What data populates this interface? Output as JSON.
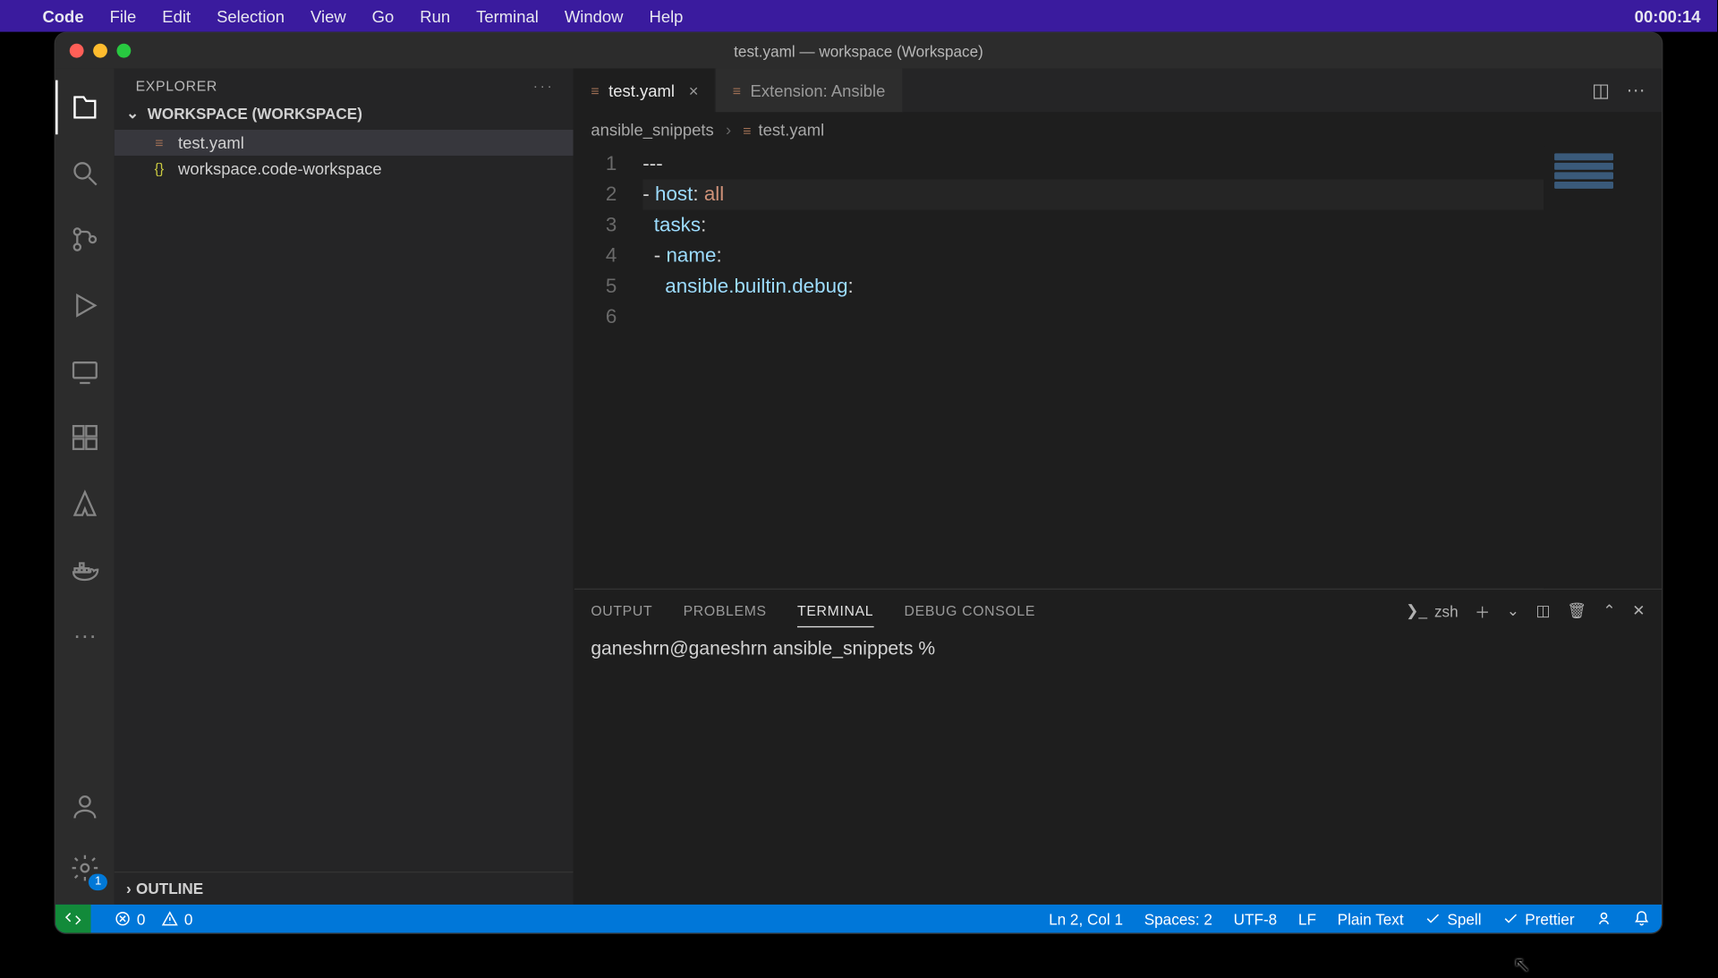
{
  "menubar": {
    "app": "Code",
    "items": [
      "File",
      "Edit",
      "Selection",
      "View",
      "Go",
      "Run",
      "Terminal",
      "Window",
      "Help"
    ],
    "clock": "00:00:14"
  },
  "window": {
    "title": "test.yaml — workspace (Workspace)"
  },
  "sidebar": {
    "title": "EXPLORER",
    "workspace": "WORKSPACE (WORKSPACE)",
    "files": [
      {
        "name": "test.yaml",
        "icon": "≡",
        "cls": "fi-yaml",
        "active": true
      },
      {
        "name": "workspace.code-workspace",
        "icon": "{}",
        "cls": "fi-json",
        "active": false
      }
    ],
    "outline": "OUTLINE"
  },
  "tabs": [
    {
      "label": "test.yaml",
      "icon": "≡",
      "active": true,
      "closable": true
    },
    {
      "label": "Extension: Ansible",
      "icon": "≡",
      "active": false,
      "closable": false
    }
  ],
  "breadcrumb": [
    {
      "label": "ansible_snippets"
    },
    {
      "label": "test.yaml",
      "icon": "≡"
    }
  ],
  "code": {
    "lines": [
      {
        "n": "1",
        "text": "---",
        "hl": false
      },
      {
        "n": "2",
        "text": "- host: all",
        "hl": true,
        "seg": [
          [
            "",
            "- "
          ],
          [
            "k-blue",
            "host"
          ],
          [
            "",
            ":"
          ],
          [
            "",
            " "
          ],
          [
            "k-orange",
            "all"
          ]
        ]
      },
      {
        "n": "3",
        "text": "  tasks:",
        "hl": false,
        "seg": [
          [
            "",
            "  "
          ],
          [
            "k-blue",
            "tasks"
          ],
          [
            "",
            ":"
          ]
        ]
      },
      {
        "n": "4",
        "text": "  - name:",
        "hl": false,
        "seg": [
          [
            "",
            "  - "
          ],
          [
            "k-blue",
            "name"
          ],
          [
            "",
            ":"
          ]
        ]
      },
      {
        "n": "5",
        "text": "    ansible.builtin.debug:",
        "hl": false,
        "seg": [
          [
            "",
            "    "
          ],
          [
            "k-blue",
            "ansible.builtin.debug"
          ],
          [
            "",
            ":"
          ]
        ]
      },
      {
        "n": "6",
        "text": "",
        "hl": false
      }
    ]
  },
  "panel": {
    "tabs": [
      "OUTPUT",
      "PROBLEMS",
      "TERMINAL",
      "DEBUG CONSOLE"
    ],
    "active": "TERMINAL",
    "shell": "zsh",
    "prompt": "ganeshrn@ganeshrn ansible_snippets %"
  },
  "status": {
    "errors": "0",
    "warnings": "0",
    "cursor": "Ln 2, Col 1",
    "indent": "Spaces: 2",
    "encoding": "UTF-8",
    "eol": "LF",
    "lang": "Plain Text",
    "spell": "Spell",
    "fmt": "Prettier"
  },
  "activity_badge": "1"
}
